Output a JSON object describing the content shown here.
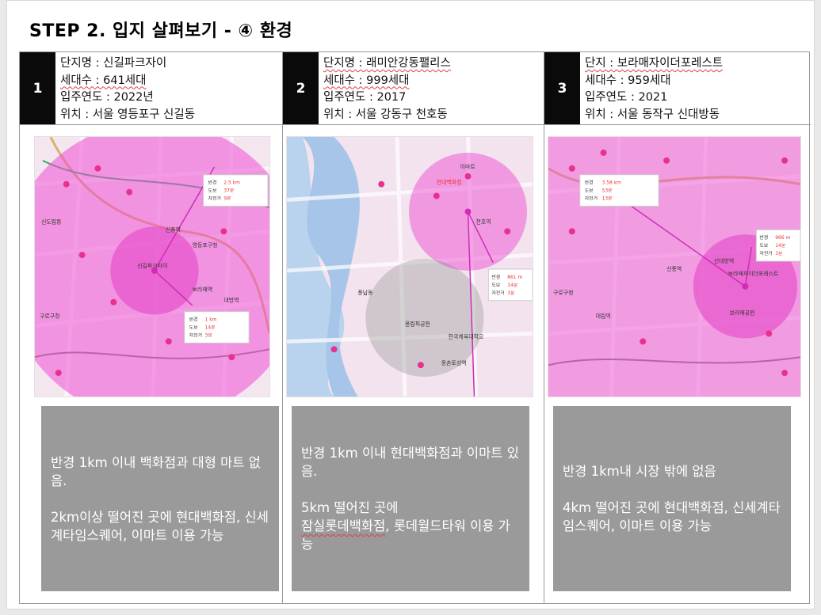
{
  "title": "STEP 2. 입지 살펴보기 - ④ 환경",
  "complexes": [
    {
      "number": "1",
      "name": "단지명 : 신길파크자이",
      "households": "세대수 : 641세대",
      "move_in": "입주연도 : 2022년",
      "location": "위치 : 서울 영등포구 신길동",
      "note_line1": "반경 1km 이내 백화점과 대형 마트 없음.",
      "note_line2": "2km이상 떨어진 곳에 현대백화점, 신세계타임스퀘어, 이마트 이용 가능",
      "popups": [
        {
          "radius_label": "반경",
          "radius": "2.5 km",
          "walk_label": "도보",
          "walk": "37분",
          "bike_label": "자전거",
          "bike": "9분"
        },
        {
          "radius_label": "반경",
          "radius": "1 km",
          "walk_label": "도보",
          "walk": "14분",
          "bike_label": "자전거",
          "bike": "3분"
        }
      ],
      "map_labels": [
        "신길파크자이",
        "영등포구청",
        "구로구청",
        "신도림동",
        "신풍역",
        "대방역",
        "보라매역"
      ]
    },
    {
      "number": "2",
      "name": "단지명 : 래미안강동팰리스",
      "households": "세대수 : 999세대",
      "move_in": "입주연도 : 2017",
      "location": "위치 : 서울 강동구 천호동",
      "note_line1": "반경 1km 이내 현대백화점과 이마트 있음.",
      "note_line2_a": "5km 떨어진 곳에",
      "note_line2_b": "잠실롯데백화점",
      "note_line2_c": ", 롯데월드타워 이용 가능",
      "popups": [
        {
          "radius_label": "반경",
          "radius": "861 m",
          "walk_label": "도보",
          "walk": "14분",
          "bike_label": "자전거",
          "bike": "3분"
        }
      ],
      "map_labels": [
        "현대백화점",
        "이마트",
        "천호역",
        "올림픽공원",
        "풍납동",
        "한국체육대학교",
        "몽촌토성역"
      ]
    },
    {
      "number": "3",
      "name": "단지 : 보라매자이더포레스트",
      "households": "세대수 : 959세대",
      "move_in": "입주연도 : 2021",
      "location": "위치 : 서울 동작구 신대방동",
      "note_line1": "반경 1km내 시장 밖에 없음",
      "note_line2": "4km 떨어진 곳에 현대백화점, 신세계타임스퀘어, 이마트 이용 가능",
      "popups": [
        {
          "radius_label": "반경",
          "radius": "3.58 km",
          "walk_label": "도보",
          "walk": "53분",
          "bike_label": "자전거",
          "bike": "13분"
        },
        {
          "radius_label": "반경",
          "radius": "966 m",
          "walk_label": "도보",
          "walk": "14분",
          "bike_label": "자전거",
          "bike": "3분"
        }
      ],
      "map_labels": [
        "보라매자이더포레스트",
        "구로구청",
        "신대방역",
        "대림역",
        "신풍역",
        "보라매공원"
      ]
    }
  ],
  "colors": {
    "header_number_bg": "#0a0a0a",
    "note_box_bg": "#9a9a9a",
    "radius_fill": "#ee4fd3",
    "map_base": "#f6e8f0"
  }
}
